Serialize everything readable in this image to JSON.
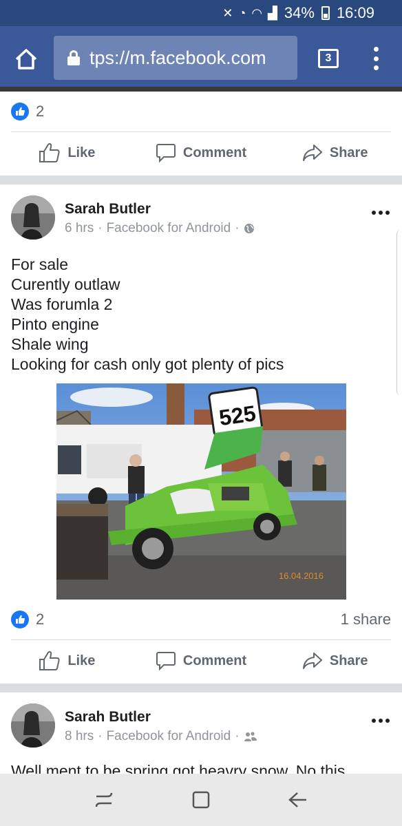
{
  "status_bar": {
    "battery": "34%",
    "time": "16:09"
  },
  "browser": {
    "url": "tps://m.facebook.com",
    "tab_count": "3"
  },
  "post1": {
    "like_count": "2",
    "actions": {
      "like": "Like",
      "comment": "Comment",
      "share": "Share"
    }
  },
  "post2": {
    "author": "Sarah Butler",
    "time": "6 hrs",
    "source": "Facebook for Android",
    "privacy_icon": "globe-icon",
    "text": "For sale\nCurently outlaw\nWas forumla 2\nPinto engine\nShale wing\nLooking for cash only got plenty of pics",
    "photo": {
      "car_number": "525",
      "date_stamp": "16.04.2016"
    },
    "like_count": "2",
    "share_count": "1 share",
    "actions": {
      "like": "Like",
      "comment": "Comment",
      "share": "Share"
    }
  },
  "post3": {
    "author": "Sarah Butler",
    "time": "8 hrs",
    "source": "Facebook for Android",
    "privacy_icon": "friends-icon",
    "text": "Well ment to be spring got heavry snow. No this"
  },
  "colors": {
    "facebook_blue": "#3b5998",
    "like_blue": "#1877f2"
  }
}
